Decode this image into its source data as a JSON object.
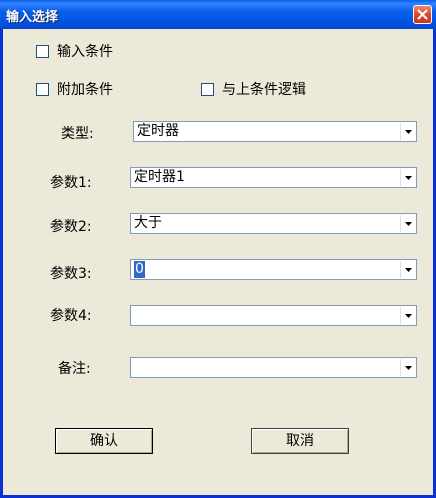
{
  "window": {
    "title": "输入选择"
  },
  "checkboxes": {
    "input_condition": "输入条件",
    "extra_condition": "附加条件",
    "and_logic": "与上条件逻辑"
  },
  "fields": {
    "type": {
      "label": "类型:",
      "value": "定时器"
    },
    "param1": {
      "label": "参数1:",
      "value": "定时器1"
    },
    "param2": {
      "label": "参数2:",
      "value": "大于"
    },
    "param3": {
      "label": "参数3:",
      "value": "0"
    },
    "param4": {
      "label": "参数4:",
      "value": ""
    },
    "remark": {
      "label": "备注:",
      "value": ""
    }
  },
  "buttons": {
    "ok": "确认",
    "cancel": "取消"
  }
}
